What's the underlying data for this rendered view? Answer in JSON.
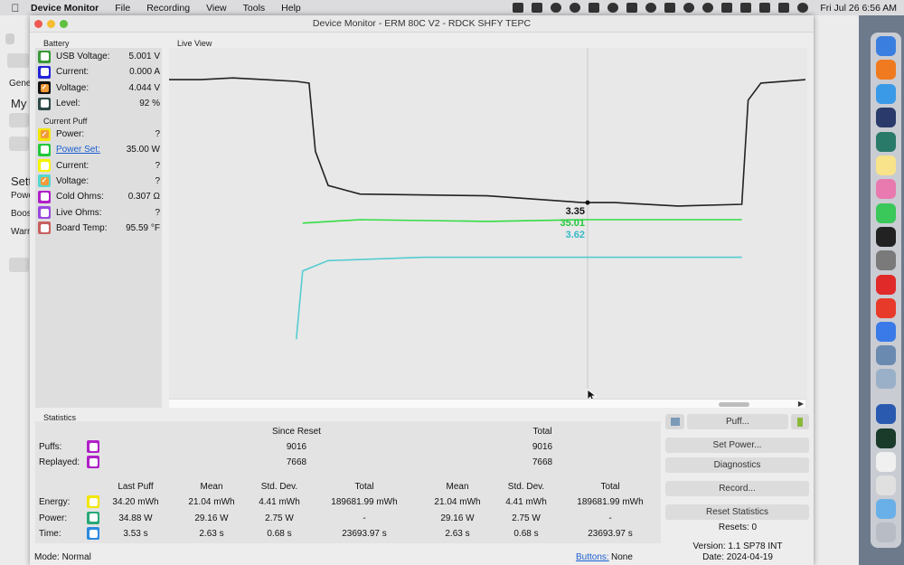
{
  "menubar": {
    "app_name": "Device Monitor",
    "items": [
      "File",
      "Recording",
      "View",
      "Tools",
      "Help"
    ],
    "clock": "Fri Jul 26  6:56 AM"
  },
  "background_window": {
    "sidebar_label": "Gene",
    "heading1": "My I",
    "heading2": "Sett",
    "labels": [
      "Powe",
      "Boos",
      "Warn"
    ]
  },
  "window": {
    "title": "Device Monitor - ERM 80C V2 - RDCK SHFY TEPC"
  },
  "battery": {
    "title": "Battery",
    "rows": [
      {
        "label": "USB Voltage:",
        "value": "5.001 V",
        "color": "#3a9a3a",
        "checked": false
      },
      {
        "label": "Current:",
        "value": "0.000 A",
        "color": "#2222d8",
        "checked": false
      },
      {
        "label": "Voltage:",
        "value": "4.044 V",
        "color": "#111111",
        "checked": true
      },
      {
        "label": "Level:",
        "value": "92 %",
        "color": "#2e4a48",
        "checked": false
      }
    ]
  },
  "current_puff": {
    "title": "Current Puff",
    "rows": [
      {
        "label": "Power:",
        "value": "?",
        "color": "#f2e600",
        "checked": true,
        "link": false
      },
      {
        "label": "Power Set:",
        "value": "35.00 W",
        "color": "#22c83a",
        "checked": false,
        "link": true
      },
      {
        "label": "Current:",
        "value": "?",
        "color": "#f4f400",
        "checked": false,
        "link": false
      },
      {
        "label": "Voltage:",
        "value": "?",
        "color": "#55d8d0",
        "checked": true,
        "link": false
      },
      {
        "label": "Cold Ohms:",
        "value": "0.307 Ω",
        "color": "#b020c8",
        "checked": false,
        "link": false
      },
      {
        "label": "Live Ohms:",
        "value": "?",
        "color": "#9a48e0",
        "checked": false,
        "link": false
      },
      {
        "label": "Board Temp:",
        "value": "95.59 °F",
        "color": "#c86060",
        "checked": false,
        "link": false
      }
    ]
  },
  "live_view": {
    "title": "Live View",
    "readout": [
      "3.35",
      "35.01",
      "3.62"
    ],
    "readout_colors": [
      "#111111",
      "#22c83a",
      "#38b8c8"
    ]
  },
  "chart_data": {
    "type": "line",
    "title": "",
    "series": [
      {
        "color": "#222222",
        "values": [
          [
            0,
            0.92
          ],
          [
            5,
            0.92
          ],
          [
            10,
            0.93
          ],
          [
            15,
            0.92
          ],
          [
            20,
            0.91
          ],
          [
            22,
            0.9
          ],
          [
            23,
            0.5
          ],
          [
            25,
            0.3
          ],
          [
            30,
            0.25
          ],
          [
            50,
            0.24
          ],
          [
            65,
            0.2
          ],
          [
            70,
            0.2
          ],
          [
            80,
            0.18
          ],
          [
            90,
            0.19
          ],
          [
            91,
            0.8
          ],
          [
            93,
            0.9
          ],
          [
            100,
            0.92
          ]
        ]
      },
      {
        "color": "#33dd44",
        "values": [
          [
            21,
            0.08
          ],
          [
            30,
            0.1
          ],
          [
            50,
            0.09
          ],
          [
            65,
            0.1
          ],
          [
            80,
            0.1
          ],
          [
            90,
            0.1
          ]
        ]
      },
      {
        "color": "#55ccd0",
        "values": [
          [
            20,
            -0.6
          ],
          [
            21,
            -0.2
          ],
          [
            25,
            -0.14
          ],
          [
            40,
            -0.12
          ],
          [
            65,
            -0.12
          ],
          [
            90,
            -0.12
          ]
        ]
      }
    ],
    "grid": false
  },
  "statistics": {
    "title": "Statistics",
    "since_reset_label": "Since Reset",
    "total_label": "Total",
    "puffs_label": "Puffs:",
    "replayed_label": "Replayed:",
    "puffs_since_reset": "9016",
    "puffs_total": "9016",
    "replayed_since_reset": "7668",
    "replayed_total": "7668",
    "puffs_color": "#b020c8",
    "replayed_color": "#b020c8",
    "columns": [
      "Last Puff",
      "Mean",
      "Std. Dev.",
      "Total",
      "Mean",
      "Std. Dev.",
      "Total"
    ],
    "rows": [
      {
        "label": "Energy:",
        "color": "#f2e600",
        "values": [
          "34.20 mWh",
          "21.04 mWh",
          "4.41 mWh",
          "189681.99 mWh",
          "21.04 mWh",
          "4.41 mWh",
          "189681.99 mWh"
        ]
      },
      {
        "label": "Power:",
        "color": "#2aa878",
        "values": [
          "34.88 W",
          "29.16 W",
          "2.75 W",
          "-",
          "29.16 W",
          "2.75 W",
          "-"
        ]
      },
      {
        "label": "Time:",
        "color": "#2a8ae0",
        "values": [
          "3.53 s",
          "2.63 s",
          "0.68 s",
          "23693.97 s",
          "2.63 s",
          "0.68 s",
          "23693.97 s"
        ]
      }
    ]
  },
  "buttons": {
    "puff": "Puff...",
    "set_power": "Set Power...",
    "diagnostics": "Diagnostics",
    "record": "Record...",
    "reset_statistics": "Reset Statistics"
  },
  "resets": "Resets: 0",
  "version": "Version: 1.1 SP78 INT",
  "date": "Date: 2024-04-19",
  "status": {
    "mode": "Mode: Normal",
    "buttons_label": "Buttons:",
    "buttons_value": "None"
  }
}
